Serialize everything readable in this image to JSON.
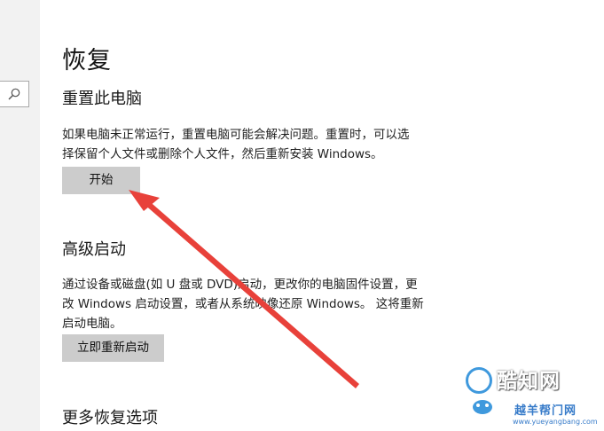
{
  "page": {
    "title": "恢复"
  },
  "reset_section": {
    "title": "重置此电脑",
    "description_line1": "如果电脑未正常运行，重置电脑可能会解决问题。重置时，可以选",
    "description_line2": "择保留个人文件或删除个人文件，然后重新安装 Windows。",
    "button_label": "开始"
  },
  "advanced_section": {
    "title": "高级启动",
    "description_line1": "通过设备或磁盘(如 U 盘或 DVD)启动，更改你的电脑固件设置，更",
    "description_line2": "改 Windows 启动设置，或者从系统映像还原 Windows。 这将重新",
    "description_line3": "启动电脑。",
    "button_label": "立即重新启动"
  },
  "more_section": {
    "title": "更多恢复选项"
  },
  "watermark": {
    "title": "酷知网",
    "subtitle": "越羊帮门网",
    "url": "www.yueyangbang.com"
  },
  "icons": {
    "search": "search-icon",
    "annotation_arrow": "arrow-annotation"
  },
  "colors": {
    "button_bg": "#cccccc",
    "arrow": "#e8413a",
    "left_panel": "#f2f2f2"
  }
}
